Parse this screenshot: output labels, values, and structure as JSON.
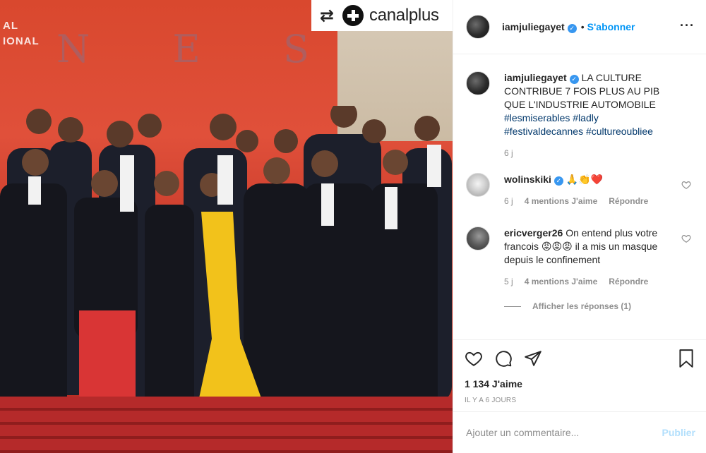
{
  "photo": {
    "banner_side_text": "AL\nIONAL",
    "banner_letters": [
      "N",
      "E",
      "S"
    ],
    "watermark": {
      "repost_icon": "repost-icon",
      "logo_icon": "canalplus-plus-icon",
      "text": "canalplus"
    }
  },
  "post": {
    "username": "iamjuliegayet",
    "verified": true,
    "separator": "•",
    "follow_label": "S'abonner",
    "more_icon": "more-horizontal-icon"
  },
  "caption": {
    "username": "iamjuliegayet",
    "text": "LA CULTURE CONTRIBUE 7 FOIS PLUS AU PIB QUE L'INDUSTRIE AUTOMOBILE",
    "hashtags": [
      "#lesmiserables",
      "#ladly",
      "#festivaldecannes",
      "#cultureoubliee"
    ],
    "time": "6 j"
  },
  "comments": [
    {
      "username": "wolinskiki",
      "verified": true,
      "text": "🙏👏❤️",
      "time": "6 j",
      "likes": "4 mentions J'aime",
      "reply": "Répondre"
    },
    {
      "username": "ericverger26",
      "verified": false,
      "text": "On entend plus votre francois 😡😡😡 il a mis un masque depuis le confinement",
      "time": "5 j",
      "likes": "4 mentions J'aime",
      "reply": "Répondre",
      "view_replies": "Afficher les réponses (1)"
    }
  ],
  "actions": {
    "like_icon": "heart-icon",
    "comment_icon": "comment-icon",
    "share_icon": "share-icon",
    "save_icon": "bookmark-icon",
    "likes_count": "1 134 J'aime",
    "time_ago": "IL Y A 6 JOURS"
  },
  "add_comment": {
    "placeholder": "Ajouter un commentaire...",
    "publish_label": "Publier"
  },
  "colors": {
    "link_blue": "#0095f6",
    "hashtag": "#00376b",
    "muted": "#8e8e8e",
    "verified": "#3897f0",
    "publish_disabled": "#b2dffc",
    "carpet_red": "#b52a2a"
  }
}
